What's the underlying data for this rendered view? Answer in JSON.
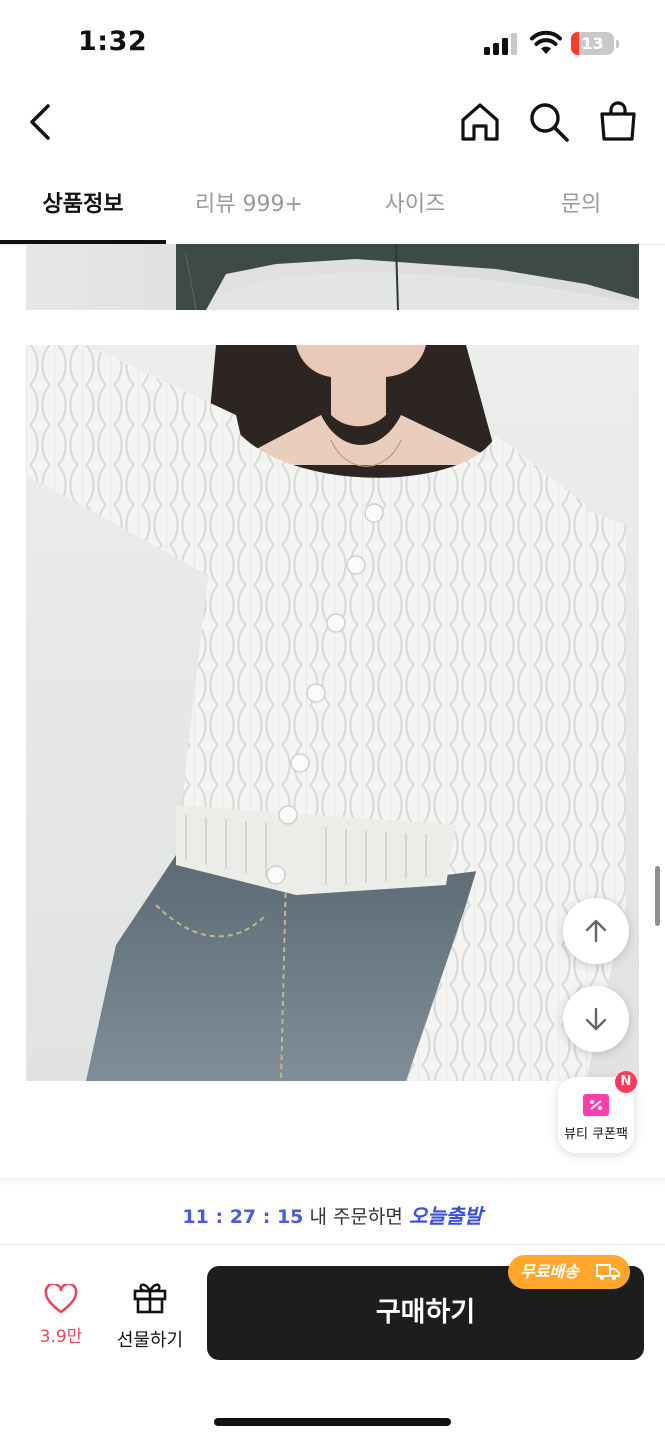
{
  "status_bar": {
    "time": "1:32",
    "battery": "13"
  },
  "tabs": [
    {
      "label": "상품정보",
      "active": true
    },
    {
      "label": "리뷰 999+",
      "active": false
    },
    {
      "label": "사이즈",
      "active": false
    },
    {
      "label": "문의",
      "active": false
    }
  ],
  "coupon": {
    "label": "뷰티 쿠폰팩",
    "badge": "N"
  },
  "delivery": {
    "timer": "11 : 27 : 15",
    "text": "내 주문하면",
    "today": "오늘출발"
  },
  "bottom_bar": {
    "like_count": "3.9만",
    "gift_label": "선물하기",
    "buy_label": "구매하기",
    "free_shipping": "무료배송"
  },
  "colors": {
    "accent_blue": "#3a4fd8",
    "like_red": "#e5485d",
    "badge_orange": "#ffa62b",
    "buy_black": "#1d1d1d"
  }
}
